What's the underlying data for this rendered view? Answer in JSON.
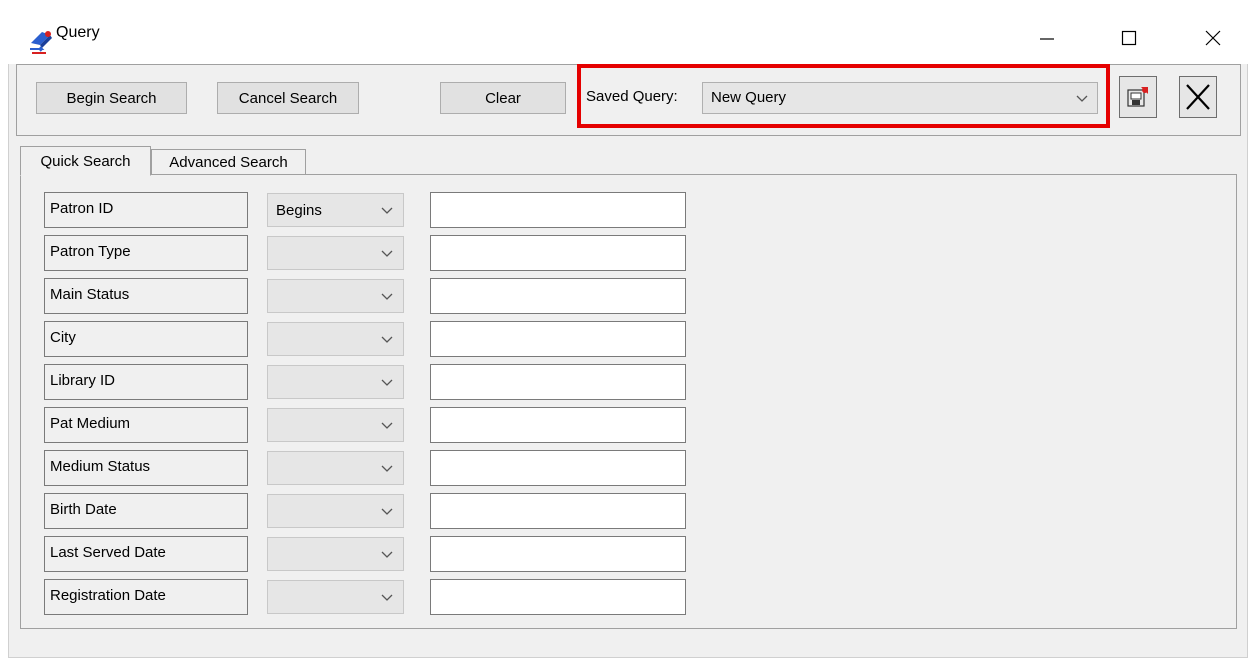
{
  "window": {
    "title": "Query",
    "controls": {
      "minimize": "—",
      "maximize": "☐",
      "close": "✕"
    }
  },
  "toolbar": {
    "begin_search": "Begin Search",
    "cancel_search": "Cancel Search",
    "clear": "Clear",
    "saved_query_label": "Saved Query:",
    "saved_query_value": "New Query",
    "save_icon": "save-query-icon",
    "delete_icon": "delete-query-icon",
    "highlight_color": "#e50000"
  },
  "tabs": [
    {
      "label": "Quick Search",
      "active": true
    },
    {
      "label": "Advanced Search",
      "active": false
    }
  ],
  "fields": [
    {
      "label": "Patron ID",
      "operator": "Begins",
      "value": ""
    },
    {
      "label": "Patron Type",
      "operator": "",
      "value": ""
    },
    {
      "label": "Main Status",
      "operator": "",
      "value": ""
    },
    {
      "label": "City",
      "operator": "",
      "value": ""
    },
    {
      "label": "Library ID",
      "operator": "",
      "value": ""
    },
    {
      "label": "Pat Medium",
      "operator": "",
      "value": ""
    },
    {
      "label": "Medium Status",
      "operator": "",
      "value": ""
    },
    {
      "label": "Birth Date",
      "operator": "",
      "value": ""
    },
    {
      "label": "Last Served Date",
      "operator": "",
      "value": ""
    },
    {
      "label": "Registration Date",
      "operator": "",
      "value": ""
    }
  ]
}
